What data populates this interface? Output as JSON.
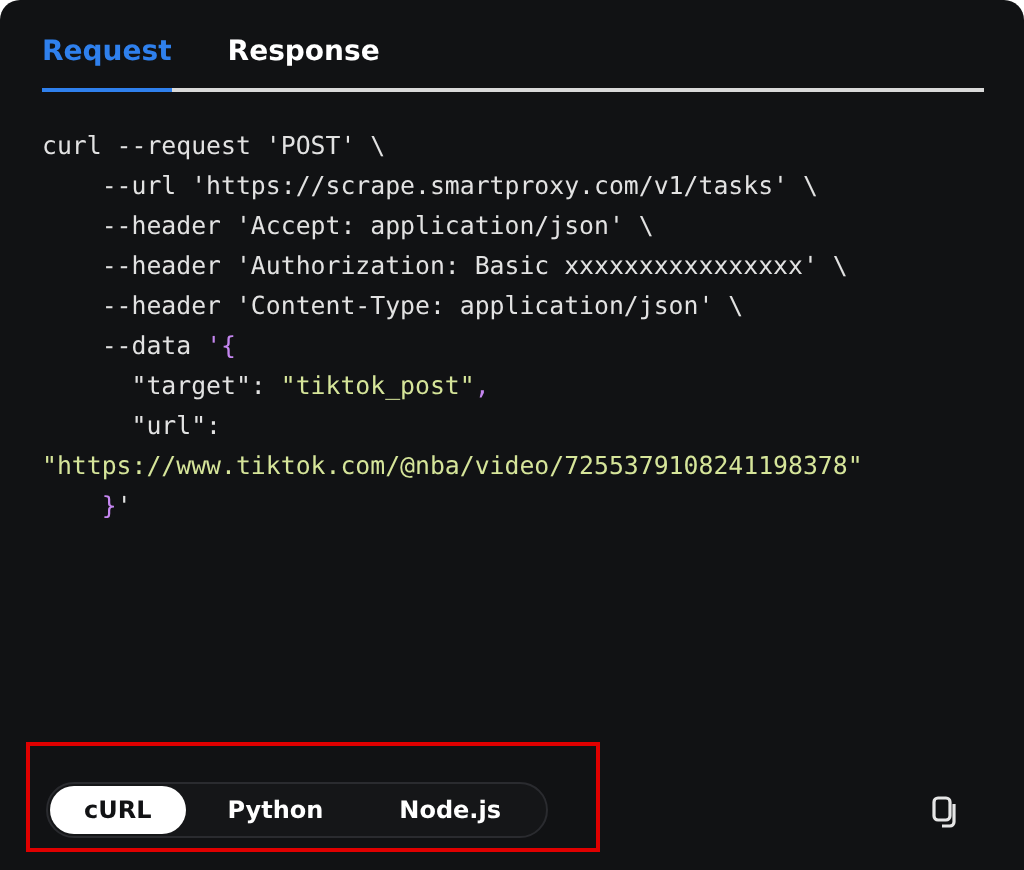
{
  "tabs": [
    {
      "label": "Request",
      "selected": true
    },
    {
      "label": "Response",
      "selected": false
    }
  ],
  "code": [
    {
      "tokens": [
        {
          "kind": "plain",
          "text": "curl --request 'POST' \\"
        }
      ]
    },
    {
      "tokens": [
        {
          "kind": "plain",
          "text": "    --url 'https://scrape.smartproxy.com/v1/tasks' \\"
        }
      ]
    },
    {
      "tokens": [
        {
          "kind": "plain",
          "text": "    --header 'Accept: application/json' \\"
        }
      ]
    },
    {
      "tokens": [
        {
          "kind": "plain",
          "text": "    --header 'Authorization: Basic xxxxxxxxxxxxxxxx' \\"
        }
      ]
    },
    {
      "tokens": [
        {
          "kind": "plain",
          "text": "    --header 'Content-Type: application/json' \\"
        }
      ]
    },
    {
      "tokens": [
        {
          "kind": "plain",
          "text": "    --data "
        },
        {
          "kind": "brace",
          "text": "'{"
        }
      ]
    },
    {
      "tokens": [
        {
          "kind": "plain",
          "text": "      \"target\": "
        },
        {
          "kind": "string",
          "text": "\"tiktok_post\""
        },
        {
          "kind": "brace",
          "text": ","
        }
      ]
    },
    {
      "tokens": [
        {
          "kind": "plain",
          "text": "      \"url\":"
        }
      ]
    },
    {
      "tokens": [
        {
          "kind": "string",
          "text": "\"https://www.tiktok.com/@nba/video/7255379108241198378\""
        }
      ]
    },
    {
      "tokens": [
        {
          "kind": "brace",
          "text": "    }"
        },
        {
          "kind": "plain",
          "text": "'"
        }
      ]
    }
  ],
  "languages": [
    {
      "label": "cURL",
      "selected": true
    },
    {
      "label": "Python",
      "selected": false
    },
    {
      "label": "Node.js",
      "selected": false
    }
  ]
}
